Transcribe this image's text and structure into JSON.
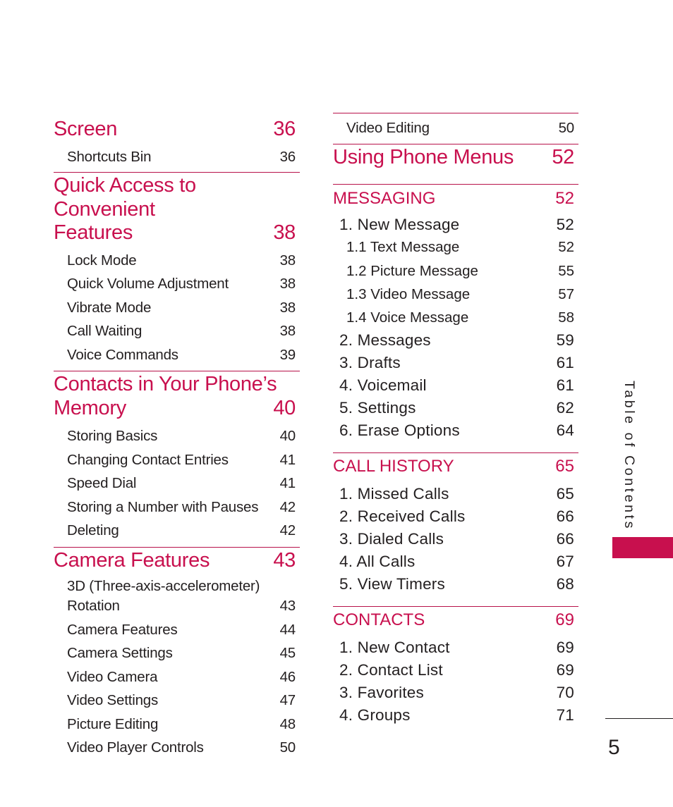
{
  "colors": {
    "accent": "#c8104e",
    "text": "#231f20"
  },
  "left_column": {
    "sections": [
      {
        "title": "Screen",
        "page": "36",
        "items": [
          {
            "label": "Shortcuts Bin",
            "page": "36"
          }
        ]
      },
      {
        "title_line1": "Quick Access to Convenient",
        "title_line2": "Features",
        "page": "38",
        "items": [
          {
            "label": "Lock Mode",
            "page": "38"
          },
          {
            "label": "Quick Volume Adjustment",
            "page": "38"
          },
          {
            "label": "Vibrate Mode",
            "page": "38"
          },
          {
            "label": "Call Waiting",
            "page": "38"
          },
          {
            "label": "Voice Commands",
            "page": "39"
          }
        ]
      },
      {
        "title_line1": "Contacts in Your Phone’s",
        "title_line2": "Memory",
        "page": "40",
        "items": [
          {
            "label": "Storing Basics",
            "page": "40"
          },
          {
            "label": "Changing Contact Entries",
            "page": "41"
          },
          {
            "label": "Speed Dial",
            "page": "41"
          },
          {
            "label": "Storing a Number with Pauses",
            "page": "42"
          },
          {
            "label": "Deleting",
            "page": "42"
          }
        ]
      },
      {
        "title": "Camera Features",
        "page": "43",
        "items": [
          {
            "label_line1": "3D (Three-axis-accelerometer)",
            "label_line2": "Rotation",
            "page": "43"
          },
          {
            "label": "Camera Features",
            "page": "44"
          },
          {
            "label": "Camera Settings",
            "page": "45"
          },
          {
            "label": "Video Camera",
            "page": "46"
          },
          {
            "label": "Video Settings",
            "page": "47"
          },
          {
            "label": "Picture Editing",
            "page": "48"
          },
          {
            "label": "Video Player Controls",
            "page": "50"
          }
        ]
      }
    ]
  },
  "right_column": {
    "top_item": {
      "label": "Video Editing",
      "page": "50"
    },
    "chapter": {
      "title": "Using Phone Menus",
      "page": "52"
    },
    "groups": [
      {
        "title": "MESSAGING",
        "page": "52",
        "items": [
          {
            "label": "1. New Message",
            "page": "52",
            "level": 1
          },
          {
            "label": "1.1 Text Message",
            "page": "52",
            "level": 2
          },
          {
            "label": "1.2 Picture Message",
            "page": "55",
            "level": 2
          },
          {
            "label": "1.3 Video Message",
            "page": "57",
            "level": 2
          },
          {
            "label": "1.4 Voice Message",
            "page": "58",
            "level": 2
          },
          {
            "label": "2. Messages",
            "page": "59",
            "level": 1
          },
          {
            "label": "3. Drafts",
            "page": "61",
            "level": 1
          },
          {
            "label": "4. Voicemail",
            "page": "61",
            "level": 1
          },
          {
            "label": "5. Settings",
            "page": "62",
            "level": 1
          },
          {
            "label": "6. Erase Options",
            "page": "64",
            "level": 1
          }
        ]
      },
      {
        "title": "CALL HISTORY",
        "page": "65",
        "items": [
          {
            "label": "1. Missed Calls",
            "page": "65",
            "level": 1
          },
          {
            "label": "2. Received Calls",
            "page": "66",
            "level": 1
          },
          {
            "label": "3. Dialed Calls",
            "page": "66",
            "level": 1
          },
          {
            "label": "4. All Calls",
            "page": "67",
            "level": 1
          },
          {
            "label": "5. View Timers",
            "page": "68",
            "level": 1
          }
        ]
      },
      {
        "title": "CONTACTS",
        "page": "69",
        "items": [
          {
            "label": "1. New Contact",
            "page": "69",
            "level": 1
          },
          {
            "label": "2. Contact List",
            "page": "69",
            "level": 1
          },
          {
            "label": "3. Favorites",
            "page": "70",
            "level": 1
          },
          {
            "label": "4. Groups",
            "page": "71",
            "level": 1
          }
        ]
      }
    ]
  },
  "side_tab": {
    "label": "Table of Contents"
  },
  "page_number": "5"
}
